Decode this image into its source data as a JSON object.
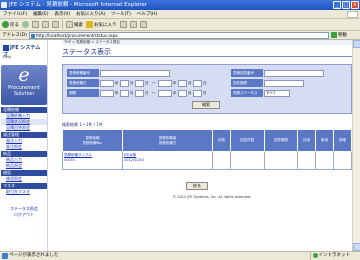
{
  "window": {
    "title": "JFE システム - 見積依頼 - Microsoft Internet Explorer"
  },
  "menubar": {
    "items": [
      "ファイル(F)",
      "編集(E)",
      "表示(V)",
      "お気に入り(A)",
      "ツール(T)",
      "ヘルプ(H)"
    ]
  },
  "toolbar": {
    "back": "戻る",
    "search": "検索",
    "favorites": "お気に入り"
  },
  "addressbar": {
    "label": "アドレス(D)",
    "url": "http://localhost/procurement/status.aspx",
    "go": "移動"
  },
  "sidebar": {
    "logo": "JFE システムズ",
    "help": "Help",
    "brand_letter": "e",
    "brand_line1": "Procurement",
    "brand_line2": "Solution",
    "sections": [
      {
        "title": "見積依頼",
        "items": [
          "見積依頼入力",
          "見積状況照会",
          "見積回答照会"
        ]
      },
      {
        "title": "発注管理",
        "items": [
          "発注入力",
          "発注照会"
        ]
      },
      {
        "title": "納品",
        "items": [
          "納品入力",
          "納品照会"
        ]
      },
      {
        "title": "検収",
        "items": [
          "検収照会"
        ]
      },
      {
        "title": "マスタ",
        "items": [
          "取引先マスタ"
        ]
      }
    ],
    "bottom_line1": "ステータス照会",
    "bottom_line2": "ログアウト"
  },
  "main": {
    "breadcrumb": "TOP > 見積依頼 > ステータス照会",
    "title": "ステータス表示",
    "form": {
      "label_request_no": "見積依頼番号",
      "label_reply_no": "見積回答番号",
      "label_request_date": "見積依頼日",
      "label_reply_date": "回答期限",
      "label_period": "期間",
      "label_status": "見積ステータス",
      "status_value": "すべて",
      "sep_year": "年",
      "sep_month": "月",
      "sep_day": "日",
      "sep_range": "〜",
      "search_button": "検索"
    },
    "result_count": "検索結果 1〜1件 / 1件",
    "table": {
      "headers": [
        "見積依頼\n見積依頼No.",
        "見積依頼者\n見積依頼日",
        "状態",
        "回答件数",
        "回答期限",
        "採用",
        "取消",
        "詳細"
      ],
      "rows": [
        {
          "col1a": "見積依頼サンプル",
          "col1b": "00001",
          "col2a": "JFE太郎",
          "col2b": "2012/02/01",
          "c3": "",
          "c4": "",
          "c5": "",
          "c6": "",
          "c7": "",
          "c8": ""
        }
      ]
    },
    "back_button": "戻る",
    "copyright": "© 2012 JFE Systems, Inc. All rights reserved."
  },
  "statusbar": {
    "text": "ページが表示されました",
    "zone": "イントラネット"
  }
}
